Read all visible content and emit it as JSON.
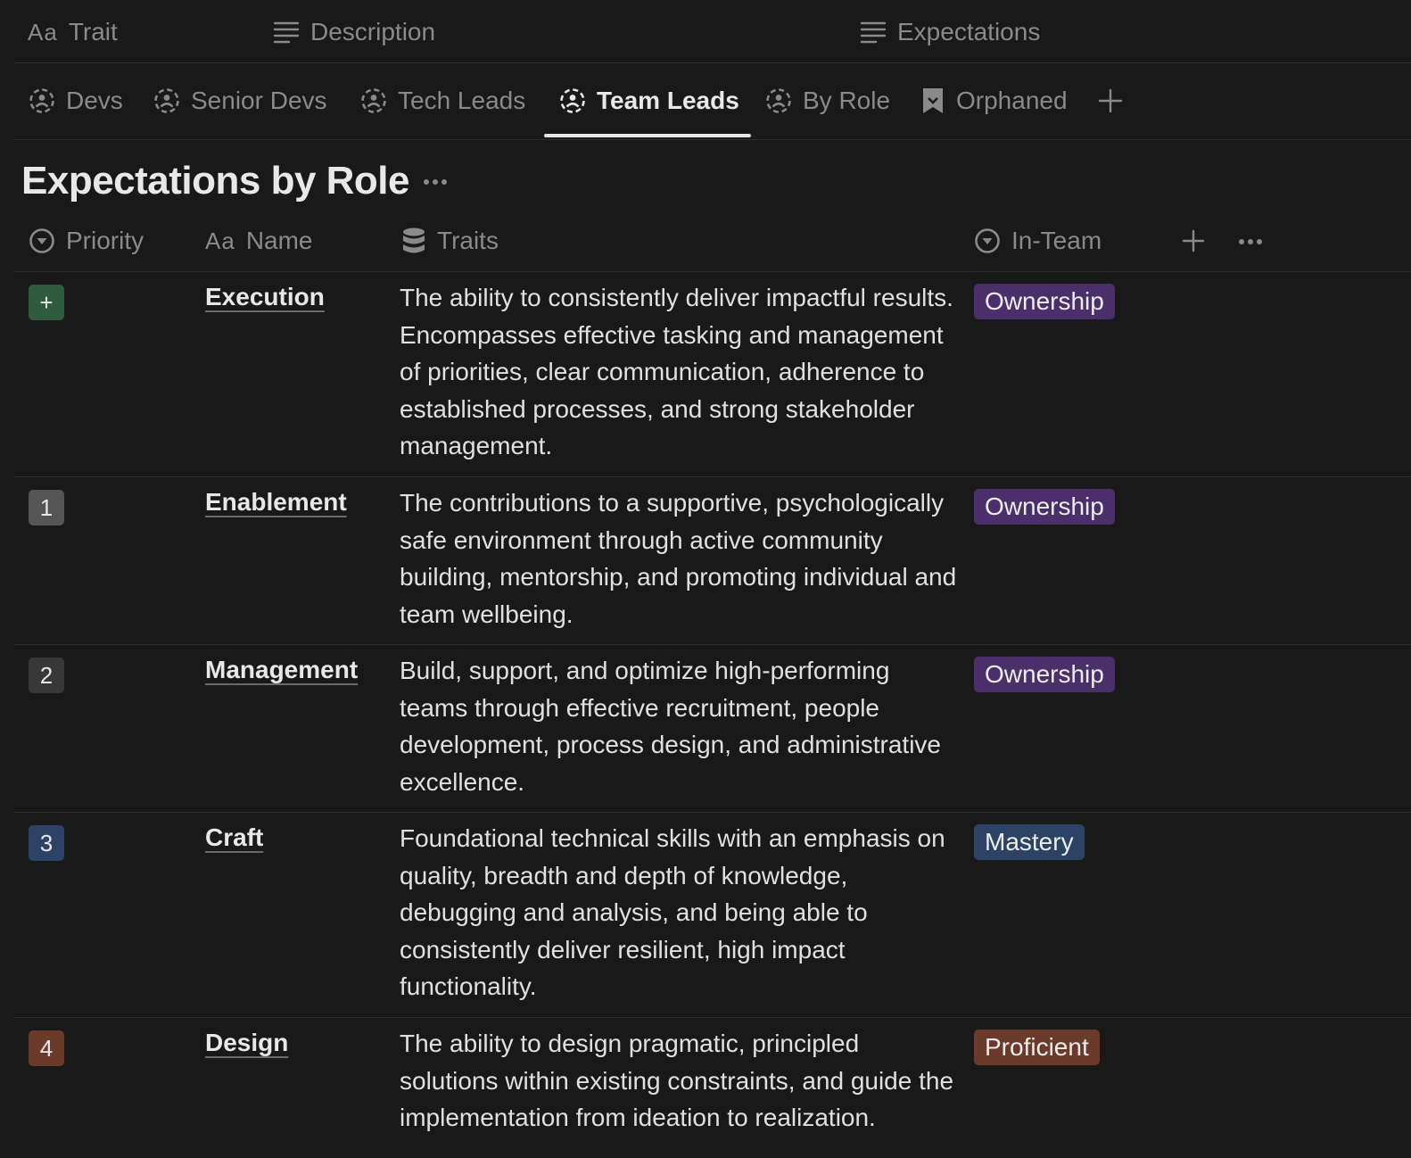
{
  "top_header": {
    "trait": {
      "prefix": "Aa",
      "label": "Trait"
    },
    "description": {
      "label": "Description"
    },
    "expectations": {
      "label": "Expectations"
    }
  },
  "tabs": [
    {
      "label": "Devs",
      "icon": "view-icon",
      "active": false
    },
    {
      "label": "Senior Devs",
      "icon": "view-icon",
      "active": false
    },
    {
      "label": "Tech Leads",
      "icon": "view-icon",
      "active": false
    },
    {
      "label": "Team Leads",
      "icon": "view-icon",
      "active": true
    },
    {
      "label": "By Role",
      "icon": "view-icon",
      "active": false
    },
    {
      "label": "Orphaned",
      "icon": "bookmark-icon",
      "active": false
    }
  ],
  "title": "Expectations by Role",
  "columns": {
    "priority": {
      "label": "Priority"
    },
    "name": {
      "prefix": "Aa",
      "label": "Name"
    },
    "traits": {
      "label": "Traits"
    },
    "in_team": {
      "label": "In-Team"
    }
  },
  "rows": [
    {
      "priority": "+",
      "priority_color": "#2f5b3e",
      "name": "Execution",
      "description": "The ability to consistently deliver impactful results. Encompasses effective tasking and management of priorities, clear communication, adherence to established processes, and strong stakeholder management.",
      "in_team": "Ownership",
      "in_team_color": "#4a2f6b"
    },
    {
      "priority": "1",
      "priority_color": "#555555",
      "name": "Enablement",
      "description": "The contributions to a supportive, psychologically safe environment through active community building, mentorship, and promoting individual and team wellbeing.",
      "in_team": "Ownership",
      "in_team_color": "#4a2f6b"
    },
    {
      "priority": "2",
      "priority_color": "#383838",
      "name": "Management",
      "description": "Build, support, and optimize high-performing teams through effective recruitment, people development, process design, and administrative excellence.",
      "in_team": "Ownership",
      "in_team_color": "#4a2f6b"
    },
    {
      "priority": "3",
      "priority_color": "#2d4366",
      "name": "Craft",
      "description": "Foundational technical skills with an emphasis on quality, breadth and depth of knowledge, debugging and analysis, and being able to consistently deliver resilient, high impact functionality.",
      "in_team": "Mastery",
      "in_team_color": "#2d4366"
    },
    {
      "priority": "4",
      "priority_color": "#6b3a2a",
      "name": "Design",
      "description": "The ability to design pragmatic, principled solutions within existing constraints, and guide the implementation from ideation to realization.",
      "in_team": "Proficient",
      "in_team_color": "#6b3a2a"
    }
  ]
}
